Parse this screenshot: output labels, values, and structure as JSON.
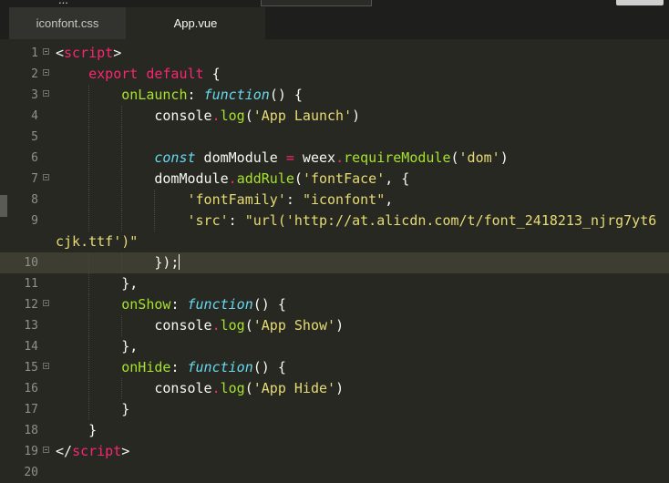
{
  "window": {
    "title_fragment": "...",
    "top_button_label": ""
  },
  "tabs": [
    {
      "label": "iconfont.css",
      "active": false
    },
    {
      "label": "App.vue",
      "active": true
    }
  ],
  "editor": {
    "current_line": 10,
    "lines": [
      {
        "n": "1",
        "fold": true,
        "guides": [],
        "tokens": [
          [
            "p",
            "<"
          ],
          [
            "tag",
            "script"
          ],
          [
            "p",
            ">"
          ]
        ]
      },
      {
        "n": "2",
        "fold": true,
        "guides": [],
        "tokens": [
          [
            "p",
            "    "
          ],
          [
            "kw",
            "export"
          ],
          [
            "p",
            " "
          ],
          [
            "kw",
            "default"
          ],
          [
            "p",
            " {"
          ]
        ]
      },
      {
        "n": "3",
        "fold": true,
        "guides": [
          1
        ],
        "tokens": [
          [
            "p",
            "        "
          ],
          [
            "fn",
            "onLaunch"
          ],
          [
            "p",
            ": "
          ],
          [
            "sto",
            "function"
          ],
          [
            "p",
            "() {"
          ]
        ]
      },
      {
        "n": "4",
        "fold": false,
        "guides": [
          1,
          2
        ],
        "tokens": [
          [
            "p",
            "            console"
          ],
          [
            "op",
            "."
          ],
          [
            "fn",
            "log"
          ],
          [
            "p",
            "("
          ],
          [
            "str",
            "'App Launch'"
          ],
          [
            "p",
            ")"
          ]
        ]
      },
      {
        "n": "5",
        "fold": false,
        "guides": [
          1,
          2
        ],
        "tokens": []
      },
      {
        "n": "6",
        "fold": false,
        "guides": [
          1,
          2
        ],
        "tokens": [
          [
            "p",
            "            "
          ],
          [
            "sto",
            "const"
          ],
          [
            "p",
            " domModule "
          ],
          [
            "op",
            "="
          ],
          [
            "p",
            " weex"
          ],
          [
            "op",
            "."
          ],
          [
            "fn",
            "requireModule"
          ],
          [
            "p",
            "("
          ],
          [
            "str",
            "'dom'"
          ],
          [
            "p",
            ")"
          ]
        ]
      },
      {
        "n": "7",
        "fold": true,
        "guides": [
          1,
          2
        ],
        "tokens": [
          [
            "p",
            "            domModule"
          ],
          [
            "op",
            "."
          ],
          [
            "fn",
            "addRule"
          ],
          [
            "p",
            "("
          ],
          [
            "str",
            "'fontFace'"
          ],
          [
            "p",
            ", {"
          ]
        ]
      },
      {
        "n": "8",
        "fold": false,
        "guides": [
          1,
          2,
          3
        ],
        "tokens": [
          [
            "p",
            "                "
          ],
          [
            "str",
            "'fontFamily'"
          ],
          [
            "p",
            ": "
          ],
          [
            "str",
            "\"iconfont\""
          ],
          [
            "p",
            ","
          ]
        ]
      },
      {
        "n": "9",
        "fold": false,
        "guides": [
          1,
          2,
          3
        ],
        "tokens": [
          [
            "p",
            "                "
          ],
          [
            "str",
            "'src'"
          ],
          [
            "p",
            ": "
          ],
          [
            "str",
            "\"url('http://at.alicdn.com/t/font_2418213_njrg7yt6"
          ]
        ]
      },
      {
        "n": "",
        "fold": false,
        "guides": [],
        "tokens": [
          [
            "str",
            "cjk.ttf')\""
          ]
        ]
      },
      {
        "n": "10",
        "fold": false,
        "guides": [
          1,
          2
        ],
        "cursor": true,
        "tokens": [
          [
            "p",
            "            });"
          ]
        ]
      },
      {
        "n": "11",
        "fold": false,
        "guides": [
          1
        ],
        "tokens": [
          [
            "p",
            "        },"
          ]
        ]
      },
      {
        "n": "12",
        "fold": true,
        "guides": [
          1
        ],
        "tokens": [
          [
            "p",
            "        "
          ],
          [
            "fn",
            "onShow"
          ],
          [
            "p",
            ": "
          ],
          [
            "sto",
            "function"
          ],
          [
            "p",
            "() {"
          ]
        ]
      },
      {
        "n": "13",
        "fold": false,
        "guides": [
          1,
          2
        ],
        "tokens": [
          [
            "p",
            "            console"
          ],
          [
            "op",
            "."
          ],
          [
            "fn",
            "log"
          ],
          [
            "p",
            "("
          ],
          [
            "str",
            "'App Show'"
          ],
          [
            "p",
            ")"
          ]
        ]
      },
      {
        "n": "14",
        "fold": false,
        "guides": [
          1
        ],
        "tokens": [
          [
            "p",
            "        },"
          ]
        ]
      },
      {
        "n": "15",
        "fold": true,
        "guides": [
          1
        ],
        "tokens": [
          [
            "p",
            "        "
          ],
          [
            "fn",
            "onHide"
          ],
          [
            "p",
            ": "
          ],
          [
            "sto",
            "function"
          ],
          [
            "p",
            "() {"
          ]
        ]
      },
      {
        "n": "16",
        "fold": false,
        "guides": [
          1,
          2
        ],
        "tokens": [
          [
            "p",
            "            console"
          ],
          [
            "op",
            "."
          ],
          [
            "fn",
            "log"
          ],
          [
            "p",
            "("
          ],
          [
            "str",
            "'App Hide'"
          ],
          [
            "p",
            ")"
          ]
        ]
      },
      {
        "n": "17",
        "fold": false,
        "guides": [
          1
        ],
        "tokens": [
          [
            "p",
            "        }"
          ]
        ]
      },
      {
        "n": "18",
        "fold": false,
        "guides": [],
        "tokens": [
          [
            "p",
            "    }"
          ]
        ]
      },
      {
        "n": "19",
        "fold": true,
        "guides": [],
        "tokens": [
          [
            "p",
            "</"
          ],
          [
            "tag",
            "script"
          ],
          [
            "p",
            ">"
          ]
        ]
      },
      {
        "n": "20",
        "fold": false,
        "guides": [],
        "tokens": []
      }
    ]
  },
  "colors": {
    "background": "#272822",
    "tag": "#f92672",
    "keyword": "#f92672",
    "function": "#a6e22e",
    "storage": "#66d9ef",
    "string": "#e6db74",
    "line_number": "#90908a"
  }
}
